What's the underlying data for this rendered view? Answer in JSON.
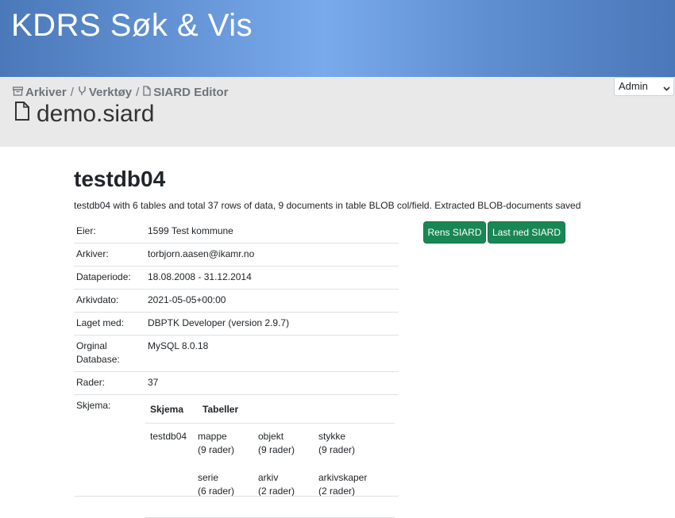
{
  "header": {
    "app_title": "KDRS Søk & Vis"
  },
  "breadcrumb": {
    "items": [
      {
        "label": "Arkiver",
        "icon": "archive-icon"
      },
      {
        "label": "Verktøy",
        "icon": "tools-icon"
      },
      {
        "label": "SIARD Editor",
        "icon": "file-icon"
      }
    ],
    "separator": "/"
  },
  "page": {
    "title": "demo.siard",
    "title_icon": "file-icon"
  },
  "user_menu": {
    "selected": "Admin"
  },
  "database": {
    "name": "testdb04",
    "description": "testdb04 with 6 tables and total 37 rows of data, 9 documents in table BLOB col/field. Extracted BLOB-documents saved"
  },
  "info": {
    "eier_label": "Eier:",
    "eier_value": "1599 Test kommune",
    "arkiver_label": "Arkiver:",
    "arkiver_value": "torbjorn.aasen@ikamr.no",
    "dataperiode_label": "Dataperiode:",
    "dataperiode_value": "18.08.2008 - 31.12.2014",
    "arkivdato_label": "Arkivdato:",
    "arkivdato_value": "2021-05-05+00:00",
    "laget_label": "Laget med:",
    "laget_value": "DBPTK Developer (version 2.9.7)",
    "orginal_label_1": "Orginal",
    "orginal_label_2": "Database:",
    "orginal_value": "MySQL 8.0.18",
    "rader_label": "Rader:",
    "rader_value": "37",
    "skjema_label": "Skjema:"
  },
  "schema": {
    "col_schema": "Skjema",
    "col_tables": "Tabeller",
    "name": "testdb04",
    "tables": [
      {
        "name": "mappe",
        "rows": "(9 rader)"
      },
      {
        "name": "objekt",
        "rows": "(9 rader)"
      },
      {
        "name": "stykke",
        "rows": "(9 rader)"
      },
      {
        "name": "serie",
        "rows": "(6 rader)"
      },
      {
        "name": "arkiv",
        "rows": "(2 rader)"
      },
      {
        "name": "arkivskaper",
        "rows": "(2 rader)"
      }
    ]
  },
  "actions": {
    "rens_label": "Rens SIARD",
    "download_label": "Last ned SIARD"
  },
  "colors": {
    "banner": "#5f8fd0",
    "button": "#198754",
    "subbar": "#e9e9e9"
  }
}
